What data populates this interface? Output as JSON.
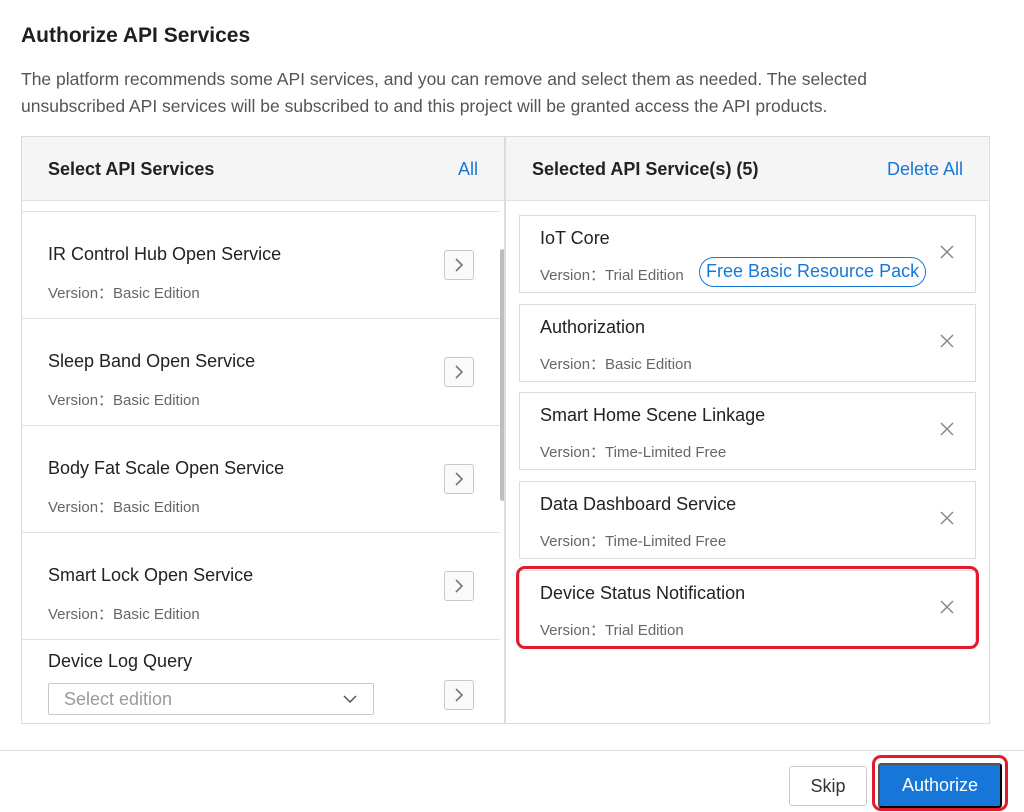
{
  "dialog": {
    "title": "Authorize API Services",
    "description": "The platform recommends some API services, and you can remove and select them as needed. The selected unsubscribed API services will be subscribed to and this project will be granted access the API products."
  },
  "left_panel": {
    "title": "Select API Services",
    "all_link": "All",
    "items": [
      {
        "name": "IR Control Hub Open Service",
        "version": "Version：Basic Edition"
      },
      {
        "name": "Sleep Band Open Service",
        "version": "Version：Basic Edition"
      },
      {
        "name": "Body Fat Scale Open Service",
        "version": "Version：Basic Edition"
      },
      {
        "name": "Smart Lock Open Service",
        "version": "Version：Basic Edition"
      },
      {
        "name": "Device Log Query",
        "select_placeholder": "Select edition"
      }
    ]
  },
  "right_panel": {
    "title": "Selected API Service(s) (5)",
    "delete_all": "Delete All",
    "items": [
      {
        "name": "IoT Core",
        "version": "Version：Trial Edition",
        "badge": "Free Basic Resource Pack"
      },
      {
        "name": "Authorization",
        "version": "Version：Basic Edition"
      },
      {
        "name": "Smart Home Scene Linkage",
        "version": "Version：Time-Limited Free"
      },
      {
        "name": "Data Dashboard Service",
        "version": "Version：Time-Limited Free"
      },
      {
        "name": "Device Status Notification",
        "version": "Version：Trial Edition"
      }
    ]
  },
  "footer": {
    "skip": "Skip",
    "authorize": "Authorize"
  },
  "colors": {
    "accent": "#1677d8",
    "highlight": "#e01b2b"
  }
}
